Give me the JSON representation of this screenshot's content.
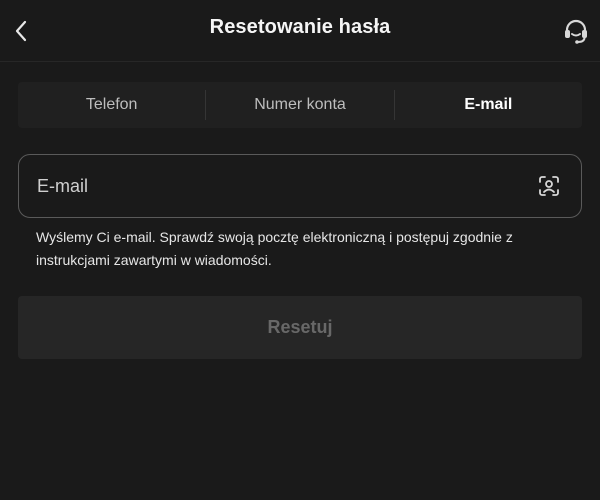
{
  "header": {
    "title": "Resetowanie hasła",
    "back_icon": "chevron-left-icon",
    "support_icon": "headset-support-icon"
  },
  "tabs": [
    {
      "label": "Telefon",
      "active": false
    },
    {
      "label": "Numer konta",
      "active": false
    },
    {
      "label": "E-mail",
      "active": true
    }
  ],
  "email_field": {
    "placeholder": "E-mail",
    "value": "",
    "icon": "contact-scan-icon"
  },
  "hint": "Wyślemy Ci e-mail. Sprawdź swoją pocztę elektroniczną i postępuj zgodnie z instrukcjami zawartymi w wiadomości.",
  "reset_button": {
    "label": "Resetuj",
    "enabled": false
  },
  "colors": {
    "background": "#1a1a1a",
    "surface": "#202020",
    "button_disabled_bg": "#262626",
    "button_disabled_text": "#686868",
    "text_primary": "#ffffff",
    "text_secondary": "#bdbdbd",
    "field_border": "#5a5a5a"
  }
}
